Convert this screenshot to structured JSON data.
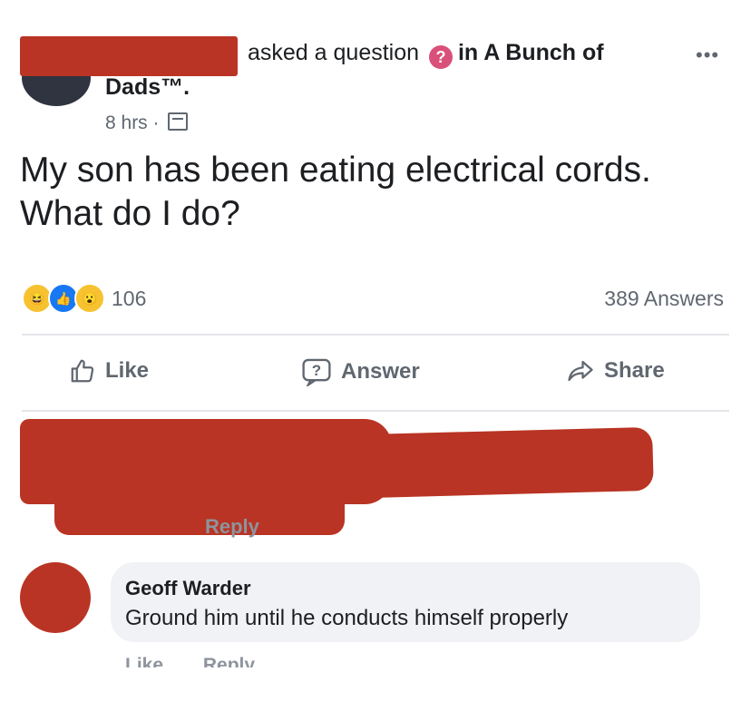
{
  "post": {
    "author": "",
    "asked_text": "asked a question",
    "in_text": "in A Bunch of",
    "group_name_continued": "Dads™.",
    "time": "8 hrs ·",
    "question_icon": "?",
    "more_icon": "•••",
    "question": "My son has been eating electrical cords. What do I do?",
    "reaction_count": "106",
    "answers_count": "389 Answers"
  },
  "actions": {
    "like": "Like",
    "answer": "Answer",
    "share": "Share"
  },
  "comments": {
    "redacted_reply_label": "Reply",
    "second": {
      "name": "Geoff Warder",
      "text": "Ground him until he conducts himself properly",
      "like": "Like",
      "reply": "Reply"
    }
  },
  "icons": {
    "reactions": [
      "haha-icon",
      "like-icon",
      "wow-icon"
    ],
    "action_icons": [
      "thumbs-up-icon",
      "question-icon",
      "share-arrow-icon"
    ]
  },
  "colors": {
    "redaction": "#b93424",
    "question_badge": "#d9507a",
    "like_blue": "#1877f2"
  }
}
